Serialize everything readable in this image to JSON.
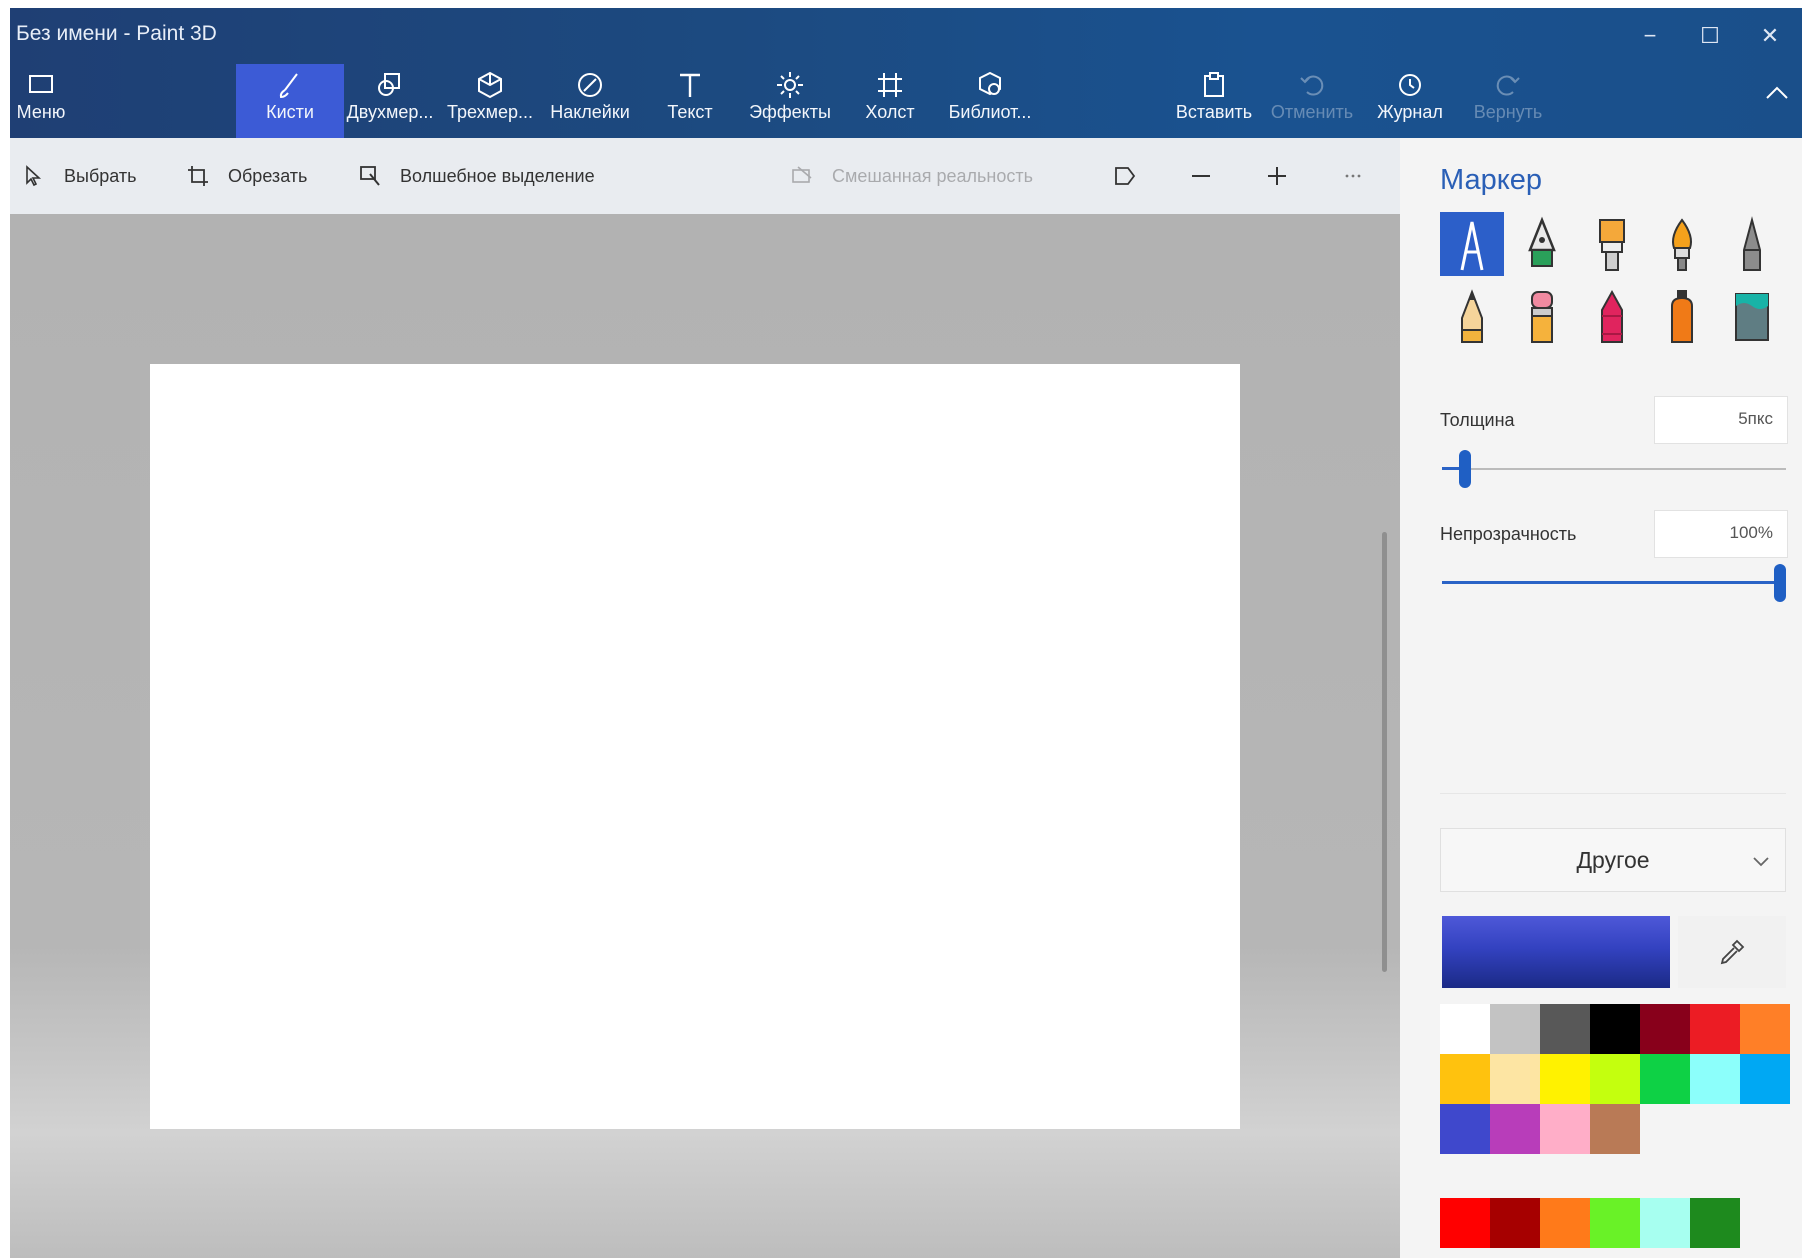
{
  "window": {
    "title": "Без имени - Paint 3D",
    "minimize": "−",
    "maximize": "☐",
    "close": "✕"
  },
  "ribbon": {
    "menu": "Меню",
    "tools": [
      {
        "label": "Кисти",
        "icon": "brush-icon"
      },
      {
        "label": "Двухмер...",
        "icon": "shapes-2d-icon"
      },
      {
        "label": "Трехмер...",
        "icon": "cube-3d-icon"
      },
      {
        "label": "Наклейки",
        "icon": "sticker-icon"
      },
      {
        "label": "Текст",
        "icon": "text-icon"
      },
      {
        "label": "Эффекты",
        "icon": "effects-icon"
      },
      {
        "label": "Холст",
        "icon": "canvas-icon"
      },
      {
        "label": "Библиот...",
        "icon": "library-icon"
      }
    ],
    "paste": "Вставить",
    "undo": "Отменить",
    "history": "Журнал",
    "redo": "Вернуть"
  },
  "subtoolbar": {
    "select": "Выбрать",
    "crop": "Обрезать",
    "magic_select": "Волшебное выделение",
    "mixed_reality": "Смешанная реальность"
  },
  "panel": {
    "title": "Маркер",
    "brushes": [
      "marker-icon",
      "calligraphy-pen-icon",
      "oil-brush-icon",
      "watercolor-icon",
      "pixel-pen-icon",
      "pencil-icon",
      "eraser-icon",
      "crayon-icon",
      "spray-can-icon",
      "fill-bucket-icon"
    ],
    "thickness_label": "Толщина",
    "thickness_value": "5пкс",
    "thickness": 0.05,
    "opacity_label": "Непрозрачность",
    "opacity_value": "100%",
    "opacity": 1.0,
    "color_mode": "Другое",
    "current_color": "#3a47c8"
  },
  "palette": [
    "#ffffff",
    "#c3c3c3",
    "#585858",
    "#000000",
    "#88001b",
    "#ec1c24",
    "#ff7f27",
    "#ffc20e",
    "#fde5a3",
    "#fff200",
    "#c4ff0e",
    "#0ed145",
    "#8cfffb",
    "#00a8f3",
    "#3f48cc",
    "#b83dba",
    "#ffaec8",
    "#b97a56"
  ],
  "custom_colors": [
    "#ff0000",
    "#a60000",
    "#ff7a1a",
    "#69f227",
    "#a7fff0",
    "#1e8a1e"
  ]
}
